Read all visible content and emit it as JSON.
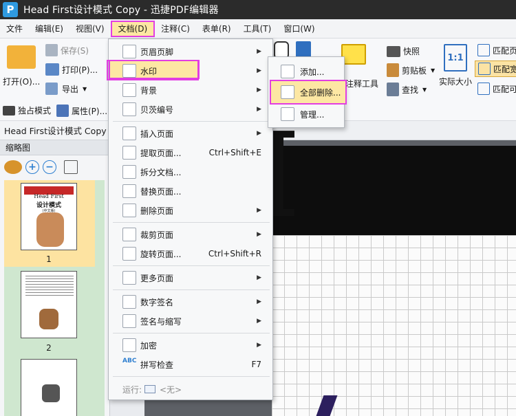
{
  "title": "Head First设计模式 Copy - 迅捷PDF编辑器",
  "app_logo": "P",
  "menubar": [
    "文件",
    "编辑(E)",
    "视图(V)",
    "文档(D)",
    "注释(C)",
    "表单(R)",
    "工具(T)",
    "窗口(W)"
  ],
  "ribbon": {
    "open": "打开(O)...",
    "save": "保存(S)",
    "print": "打印(P)...",
    "export": "导出",
    "unique_mode": "独占模式",
    "properties": "属性(P)...",
    "note_tool": "注释工具",
    "snapshot": "快照",
    "clipboard": "剪贴板",
    "find": "查找",
    "actual_size": "实际大小",
    "actual_size_icon": "1:1",
    "fit1": "匹配页",
    "fit2": "匹配宽",
    "fit3": "匹配可"
  },
  "doc_tab": "Head First设计模式 Copy",
  "thumbnails": {
    "title": "缩略图",
    "page_numbers": [
      "1",
      "2"
    ],
    "cover_title": "Head First",
    "cover_subtitle": "设计模式",
    "cover_note": "(中文版)"
  },
  "document_menu": [
    {
      "label": "页眉页脚",
      "shortcut": "",
      "has_sub": true
    },
    {
      "label": "水印",
      "shortcut": "",
      "has_sub": true
    },
    {
      "label": "背景",
      "shortcut": "",
      "has_sub": true
    },
    {
      "label": "贝茨编号",
      "shortcut": "",
      "has_sub": true
    },
    {
      "label": "插入页面",
      "shortcut": "",
      "has_sub": true
    },
    {
      "label": "提取页面...",
      "shortcut": "Ctrl+Shift+E",
      "has_sub": false
    },
    {
      "label": "拆分文档...",
      "shortcut": "",
      "has_sub": false
    },
    {
      "label": "替换页面...",
      "shortcut": "",
      "has_sub": false
    },
    {
      "label": "删除页面",
      "shortcut": "",
      "has_sub": true
    },
    {
      "label": "裁剪页面",
      "shortcut": "",
      "has_sub": true
    },
    {
      "label": "旋转页面...",
      "shortcut": "Ctrl+Shift+R",
      "has_sub": false
    },
    {
      "label": "更多页面",
      "shortcut": "",
      "has_sub": true
    },
    {
      "label": "数字签名",
      "shortcut": "",
      "has_sub": true
    },
    {
      "label": "签名与缩写",
      "shortcut": "",
      "has_sub": true
    },
    {
      "label": "加密",
      "shortcut": "",
      "has_sub": true
    },
    {
      "label": "拼写检查",
      "shortcut": "F7",
      "has_sub": false
    }
  ],
  "run_label": "运行:",
  "run_value": "<无>",
  "watermark_submenu": [
    "添加...",
    "全部删除...",
    "管理..."
  ],
  "abc_icon": "ABC",
  "viewer_letter": "H"
}
